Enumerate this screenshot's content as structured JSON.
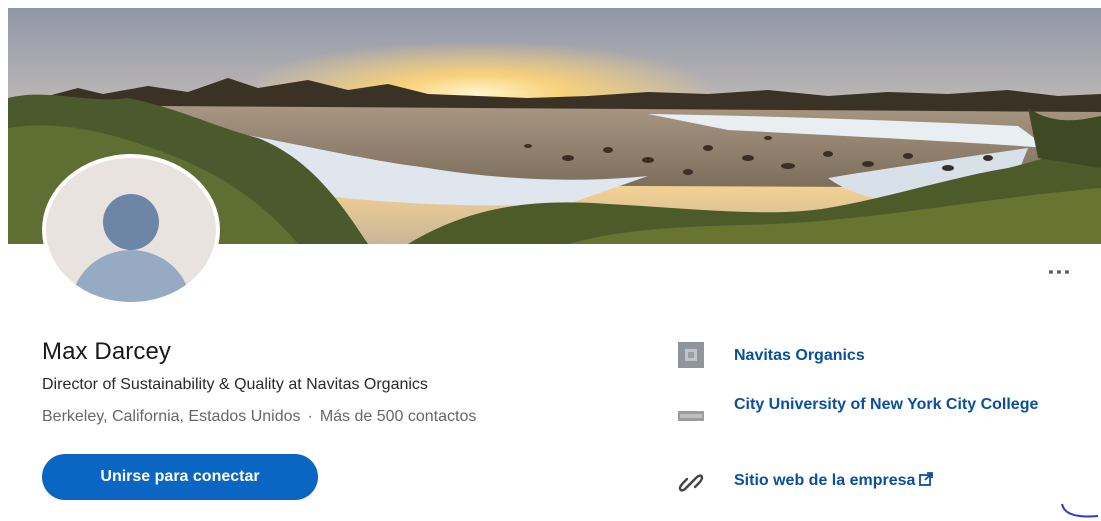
{
  "profile": {
    "name": "Max Darcey",
    "headline": "Director of Sustainability & Quality at Navitas Organics",
    "location": "Berkeley, California, Estados Unidos",
    "separator": "·",
    "connections": "Más de 500 contactos",
    "connect_label": "Unirse para conectar",
    "more_label": "..."
  },
  "side": {
    "company": "Navitas Organics",
    "education": "City University of New York City College",
    "website": "Sitio web de la empresa"
  },
  "colors": {
    "primary": "#0a66c2",
    "link": "#0a4f9e",
    "text": "#191919",
    "muted": "#666666"
  },
  "icons": {
    "company": "company-logo-icon",
    "education": "school-logo-icon",
    "website": "link-icon",
    "external": "external-link-icon",
    "more": "ellipsis-icon"
  }
}
